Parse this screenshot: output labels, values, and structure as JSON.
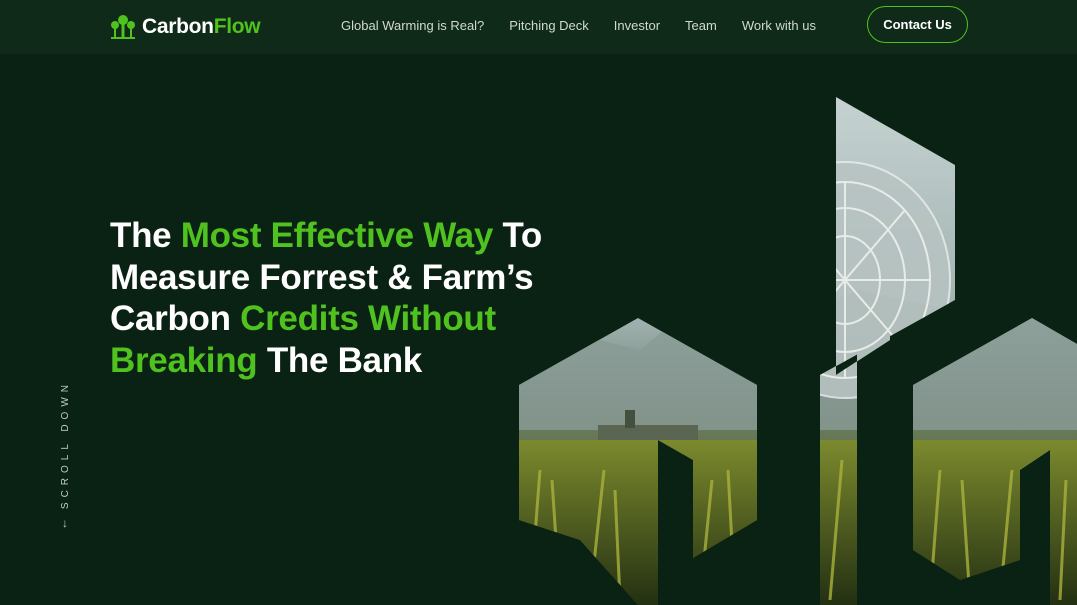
{
  "brand": {
    "part1": "Carbon",
    "part2": "Flow",
    "accent": "#4fc21f"
  },
  "nav": {
    "items": [
      "Global Warming is Real?",
      "Pitching Deck",
      "Investor",
      "Team",
      "Work with us"
    ]
  },
  "contact": {
    "label": "Contact Us"
  },
  "hero": {
    "t1": "The ",
    "t2": "Most Effective Way",
    "t3": " To",
    "t4": "Measure Forrest & Farm’s",
    "t5": "Carbon ",
    "t6": "Credits Without",
    "t7": "Breaking",
    "t8": " The Bank"
  },
  "scroll": {
    "label": "SCROLL DOWN",
    "arrow": "←"
  },
  "colors": {
    "background": "#0a2213",
    "topbar": "#0f2a18",
    "accent": "#4fc21f"
  },
  "icons": [
    "tree-icon",
    "arrow-down-icon"
  ]
}
